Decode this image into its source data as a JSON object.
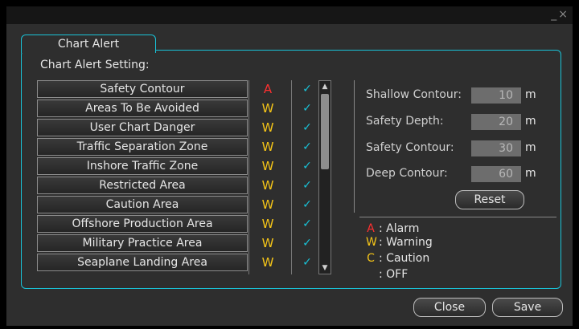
{
  "window": {
    "minimize_glyph": "_",
    "close_glyph": "×"
  },
  "tab": {
    "label": "Chart Alert"
  },
  "setting_label": "Chart Alert Setting:",
  "colors": {
    "alarm": "#ff3030",
    "warning": "#f5c518",
    "caution": "#f5c518",
    "accent": "#19c3d8"
  },
  "alerts": [
    {
      "name": "Safety Contour",
      "level": "A",
      "checked": "✓"
    },
    {
      "name": "Areas To Be Avoided",
      "level": "W",
      "checked": "✓"
    },
    {
      "name": "User Chart Danger",
      "level": "W",
      "checked": "✓"
    },
    {
      "name": "Traffic Separation Zone",
      "level": "W",
      "checked": "✓"
    },
    {
      "name": "Inshore Traffic Zone",
      "level": "W",
      "checked": "✓"
    },
    {
      "name": "Restricted Area",
      "level": "W",
      "checked": "✓"
    },
    {
      "name": "Caution Area",
      "level": "W",
      "checked": "✓"
    },
    {
      "name": "Offshore Production Area",
      "level": "W",
      "checked": "✓"
    },
    {
      "name": "Military Practice Area",
      "level": "W",
      "checked": "✓"
    },
    {
      "name": "Seaplane Landing Area",
      "level": "W",
      "checked": "✓"
    }
  ],
  "contours": {
    "shallow": {
      "label": "Shallow Contour:",
      "value": "10",
      "unit": "m"
    },
    "safety_depth": {
      "label": "Safety Depth:",
      "value": "20",
      "unit": "m"
    },
    "safety": {
      "label": "Safety Contour:",
      "value": "30",
      "unit": "m"
    },
    "deep": {
      "label": "Deep Contour:",
      "value": "60",
      "unit": "m"
    }
  },
  "buttons": {
    "reset": "Reset",
    "close": "Close",
    "save": "Save"
  },
  "legend": [
    {
      "symbol": "A",
      "text": ": Alarm"
    },
    {
      "symbol": "W",
      "text": ": Warning"
    },
    {
      "symbol": "C",
      "text": ": Caution"
    },
    {
      "symbol": "",
      "text": ": OFF"
    }
  ]
}
